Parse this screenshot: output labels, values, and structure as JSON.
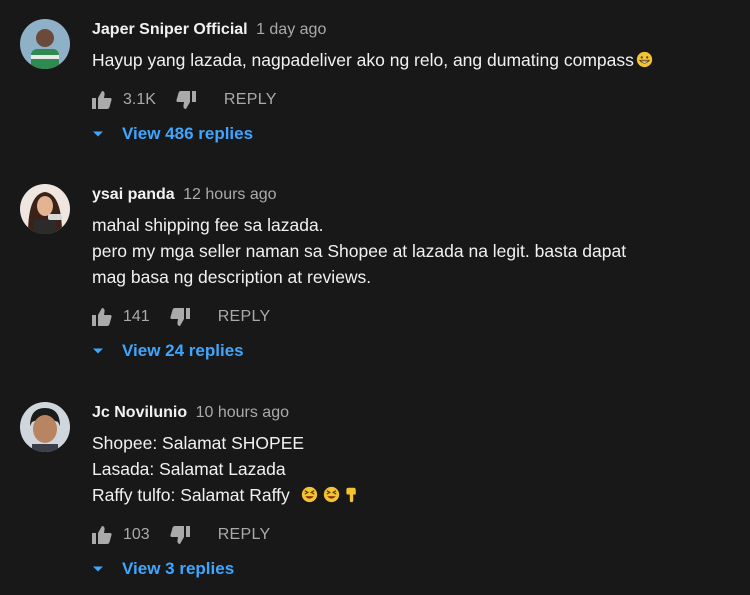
{
  "comments": [
    {
      "author": "Japer Sniper Official",
      "time": "1 day ago",
      "lines": [
        "Hayup yang lazada, nagpadeliver ako ng relo, ang dumating compass"
      ],
      "likes": "3.1K",
      "reply_label": "REPLY",
      "view_replies": "View 486 replies"
    },
    {
      "author": "ysai panda",
      "time": "12 hours ago",
      "lines": [
        "mahal shipping fee sa lazada.",
        "pero my mga seller naman sa Shopee at lazada na legit. basta dapat",
        "mag basa ng description at reviews."
      ],
      "likes": "141",
      "reply_label": "REPLY",
      "view_replies": "View 24 replies"
    },
    {
      "author": "Jc Novilunio",
      "time": "10 hours ago",
      "lines": [
        "Shopee: Salamat SHOPEE",
        "Lasada: Salamat Lazada",
        "Raffy tulfo: Salamat Raffy"
      ],
      "likes": "103",
      "reply_label": "REPLY",
      "view_replies": "View 3 replies"
    }
  ],
  "icons": {
    "like": "thumbs-up-icon",
    "dislike": "thumbs-down-icon",
    "expand": "chevron-down-icon",
    "emoji_grin": "grinning-face-emoji",
    "emoji_squint": "squinting-face-emoji",
    "emoji_point": "pointing-down-emoji"
  },
  "colors": {
    "background": "#181818",
    "text": "#f1f1f1",
    "muted": "#aaaaaa",
    "link": "#3ea6ff",
    "emoji": "#f4c430"
  }
}
